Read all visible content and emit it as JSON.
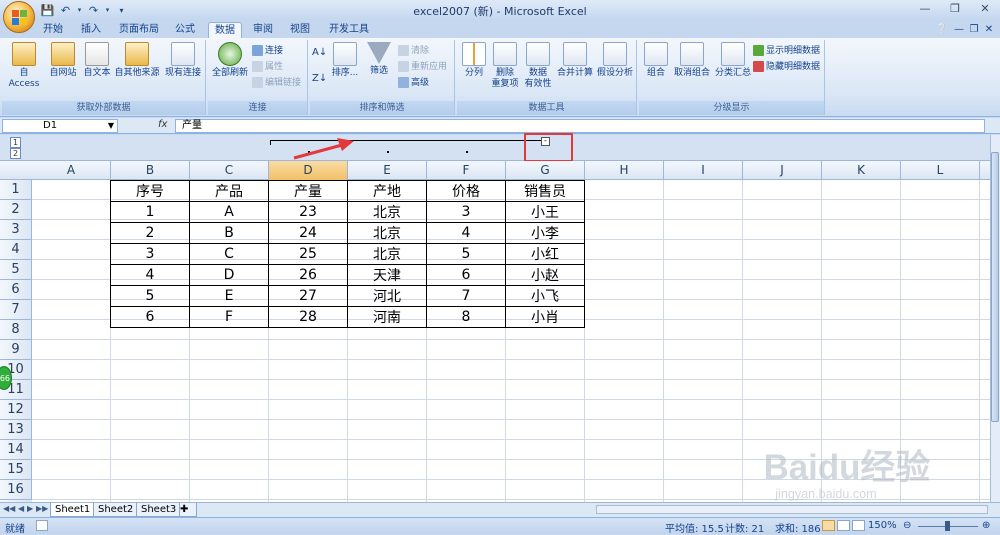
{
  "window": {
    "title": "excel2007 (新) - Microsoft Excel"
  },
  "ribbon": {
    "tabs": [
      {
        "label": "开始"
      },
      {
        "label": "插入"
      },
      {
        "label": "页面布局"
      },
      {
        "label": "公式"
      },
      {
        "label": "数据",
        "active": true
      },
      {
        "label": "审阅"
      },
      {
        "label": "视图"
      },
      {
        "label": "开发工具"
      }
    ],
    "groups": {
      "external": {
        "label": "获取外部数据",
        "buttons": [
          "自 Access",
          "自网站",
          "自文本",
          "自其他来源",
          "现有连接"
        ]
      },
      "connections": {
        "label": "连接",
        "refresh_all": "全部刷新",
        "connections": "连接",
        "properties": "属性",
        "edit_links": "编辑链接"
      },
      "sort_filter": {
        "label": "排序和筛选",
        "sort": "排序...",
        "filter": "筛选",
        "clear": "清除",
        "reapply": "重新应用",
        "advanced": "高级"
      },
      "data_tools": {
        "label": "数据工具",
        "text_to_columns": "分列",
        "remove_dup_1": "删除",
        "remove_dup_2": "重复项",
        "validation_1": "数据",
        "validation_2": "有效性",
        "consolidate": "合并计算",
        "what_if": "假设分析"
      },
      "outline": {
        "label": "分级显示",
        "group": "组合",
        "ungroup": "取消组合",
        "subtotal": "分类汇总",
        "show_detail": "显示明细数据",
        "hide_detail": "隐藏明细数据"
      }
    }
  },
  "formula_bar": {
    "name_box": "D1",
    "fx": "fx",
    "content": "产量"
  },
  "outline_levels": [
    "1",
    "2"
  ],
  "columns": [
    "A",
    "B",
    "C",
    "D",
    "E",
    "F",
    "G",
    "H",
    "I",
    "J",
    "K",
    "L"
  ],
  "rows": [
    "1",
    "2",
    "3",
    "4",
    "5",
    "6",
    "7",
    "8",
    "9",
    "10",
    "11",
    "12",
    "13",
    "14",
    "15",
    "16"
  ],
  "table": {
    "header": [
      "序号",
      "产品",
      "产量",
      "产地",
      "价格",
      "销售员"
    ],
    "rows": [
      [
        "1",
        "A",
        "23",
        "北京",
        "3",
        "小王"
      ],
      [
        "2",
        "B",
        "24",
        "北京",
        "4",
        "小李"
      ],
      [
        "3",
        "C",
        "25",
        "北京",
        "5",
        "小红"
      ],
      [
        "4",
        "D",
        "26",
        "天津",
        "6",
        "小赵"
      ],
      [
        "5",
        "E",
        "27",
        "河北",
        "7",
        "小飞"
      ],
      [
        "6",
        "F",
        "28",
        "河南",
        "8",
        "小肖"
      ]
    ]
  },
  "sheets": [
    "Sheet1",
    "Sheet2",
    "Sheet3"
  ],
  "status": {
    "ready": "就绪",
    "average": "平均值: 15.5",
    "count": "计数: 21",
    "sum": "求和: 186",
    "zoom": "150%"
  },
  "badge": "66",
  "watermark": {
    "brand": "Baidu经验",
    "url": "jingyan.baidu.com"
  },
  "colors": {
    "highlight_box": "#e23a3a",
    "arrow": "#e23a3a"
  }
}
